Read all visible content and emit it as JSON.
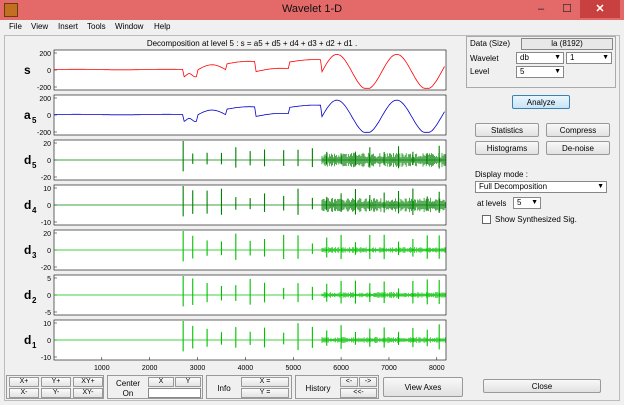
{
  "window": {
    "title": "Wavelet 1-D",
    "min": "–",
    "max": "☐",
    "close": "✕"
  },
  "menu": [
    "File",
    "View",
    "Insert",
    "Tools",
    "Window",
    "Help"
  ],
  "plot": {
    "title": "Decomposition at level 5 : s = a5 + d5 + d4 + d3 + d2 + d1 .",
    "x_ticks": [
      "1000",
      "2000",
      "3000",
      "4000",
      "5000",
      "6000",
      "7000",
      "8000"
    ],
    "panels": [
      {
        "label": "s",
        "sub": "",
        "yticks": [
          "200",
          "0",
          "-200"
        ],
        "color": "#ff0000",
        "kind": "signal"
      },
      {
        "label": "a",
        "sub": "5",
        "yticks": [
          "200",
          "0",
          "-200"
        ],
        "color": "#0000c8",
        "kind": "signal"
      },
      {
        "label": "d",
        "sub": "5",
        "yticks": [
          "20",
          "0",
          "-20"
        ],
        "color": "#008000",
        "kind": "detail"
      },
      {
        "label": "d",
        "sub": "4",
        "yticks": [
          "10",
          "0",
          "-10"
        ],
        "color": "#008000",
        "kind": "detail"
      },
      {
        "label": "d",
        "sub": "3",
        "yticks": [
          "20",
          "0",
          "-20"
        ],
        "color": "#00c000",
        "kind": "detail"
      },
      {
        "label": "d",
        "sub": "2",
        "yticks": [
          "5",
          "0",
          "-5"
        ],
        "color": "#00c000",
        "kind": "detail"
      },
      {
        "label": "d",
        "sub": "1",
        "yticks": [
          "10",
          "0",
          "-10"
        ],
        "color": "#00c000",
        "kind": "detail"
      }
    ]
  },
  "right": {
    "data_label": "Data  (Size)",
    "data_value": "la  (8192)",
    "wavelet_label": "Wavelet",
    "wavelet_family": "db",
    "wavelet_order": "1",
    "level_label": "Level",
    "level_value": "5",
    "analyze": "Analyze",
    "statistics": "Statistics",
    "compress": "Compress",
    "histograms": "Histograms",
    "denoise": "De-noise",
    "display_mode_label": "Display mode :",
    "display_mode_value": "Full Decomposition",
    "at_levels_label": "at levels",
    "at_levels_value": "5",
    "show_synth": "Show Synthesized Sig.",
    "close": "Close"
  },
  "toolbar": {
    "xplus": "X+",
    "yplus": "Y+",
    "xyplus": "XY+",
    "xminus": "X-",
    "yminus": "Y-",
    "xyminus": "XY-",
    "center_on_1": "Center",
    "center_on_2": "On",
    "center_x": "X",
    "center_y": "Y",
    "info": "Info",
    "info_x": "X =",
    "info_y": "Y =",
    "history": "History",
    "hist_back": "<-",
    "hist_fwd": "->",
    "hist_reset": "<<-",
    "view_axes": "View Axes"
  }
}
